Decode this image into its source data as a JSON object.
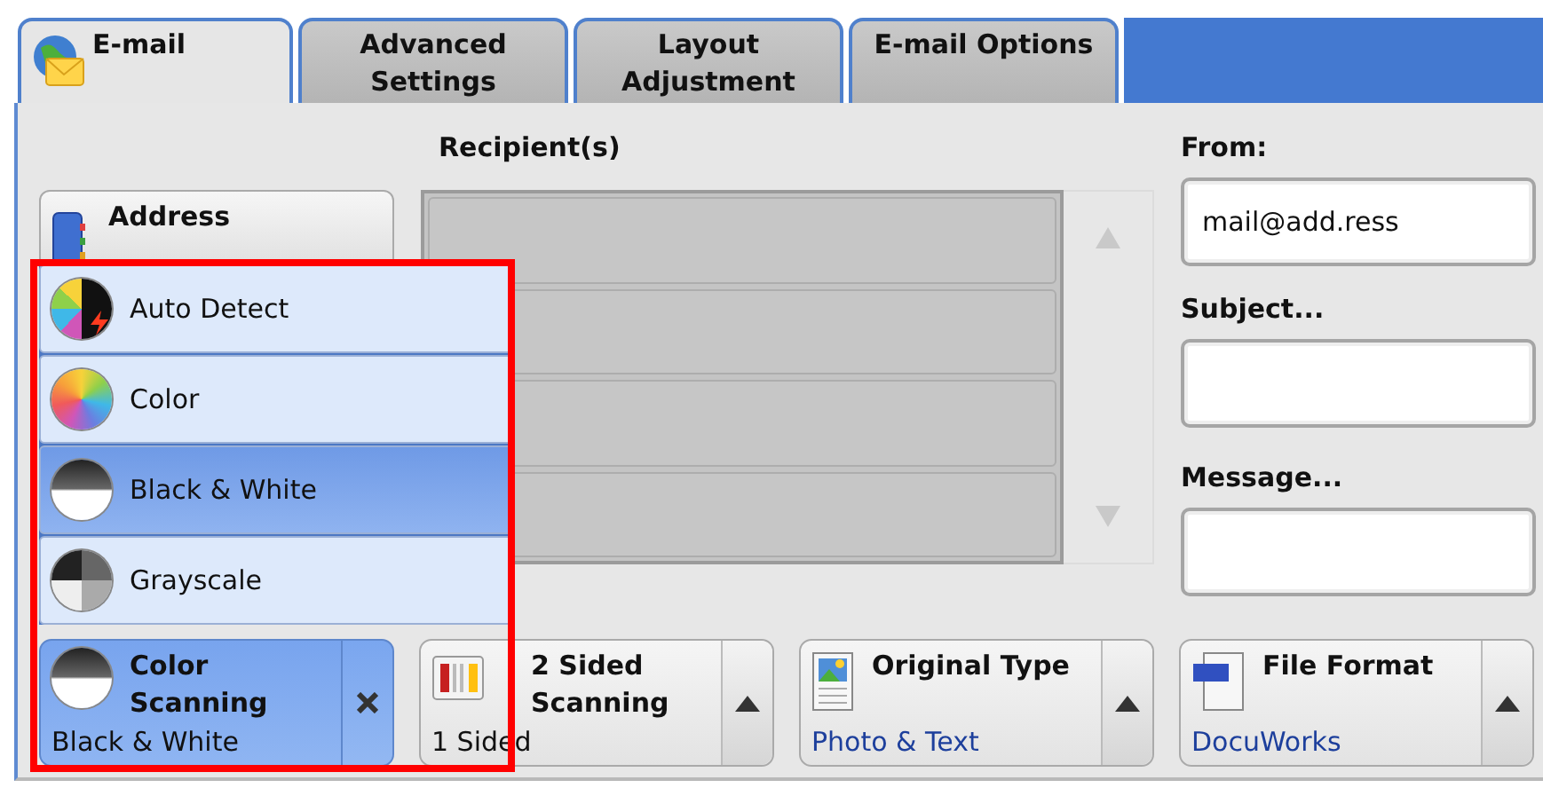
{
  "tabs": [
    {
      "label": "E-mail",
      "selected": true
    },
    {
      "label": "Advanced\nSettings",
      "selected": false
    },
    {
      "label": "Layout\nAdjustment",
      "selected": false
    },
    {
      "label": "E-mail Options",
      "selected": false
    }
  ],
  "address_book_button": {
    "label": "Address"
  },
  "recipients": {
    "label": "Recipient(s)"
  },
  "fields": [
    {
      "label": "From:",
      "value": "mail@add.ress"
    },
    {
      "label": "Subject..."
    },
    {
      "label": "Message..."
    }
  ],
  "color_menu": {
    "items": [
      {
        "label": "Auto Detect",
        "kind": "auto",
        "selected": false
      },
      {
        "label": "Color",
        "kind": "color",
        "selected": false
      },
      {
        "label": "Black & White",
        "kind": "bw",
        "selected": true
      },
      {
        "label": "Grayscale",
        "kind": "gray",
        "selected": false
      }
    ]
  },
  "feature_buttons": [
    {
      "kind": "color_mode",
      "title": "Color\nScanning",
      "value": "Black & White",
      "value_link": false,
      "selected": true,
      "clearable": true
    },
    {
      "kind": "sides",
      "title": "2 Sided\nScanning",
      "value": "1 Sided",
      "value_link": false,
      "selected": false,
      "clearable": false
    },
    {
      "kind": "original_type",
      "title": "Original Type",
      "value": "Photo & Text",
      "value_link": true,
      "selected": false,
      "clearable": false
    },
    {
      "kind": "file_format",
      "title": "File Format",
      "value": "DocuWorks",
      "value_link": true,
      "selected": false,
      "clearable": false
    }
  ]
}
